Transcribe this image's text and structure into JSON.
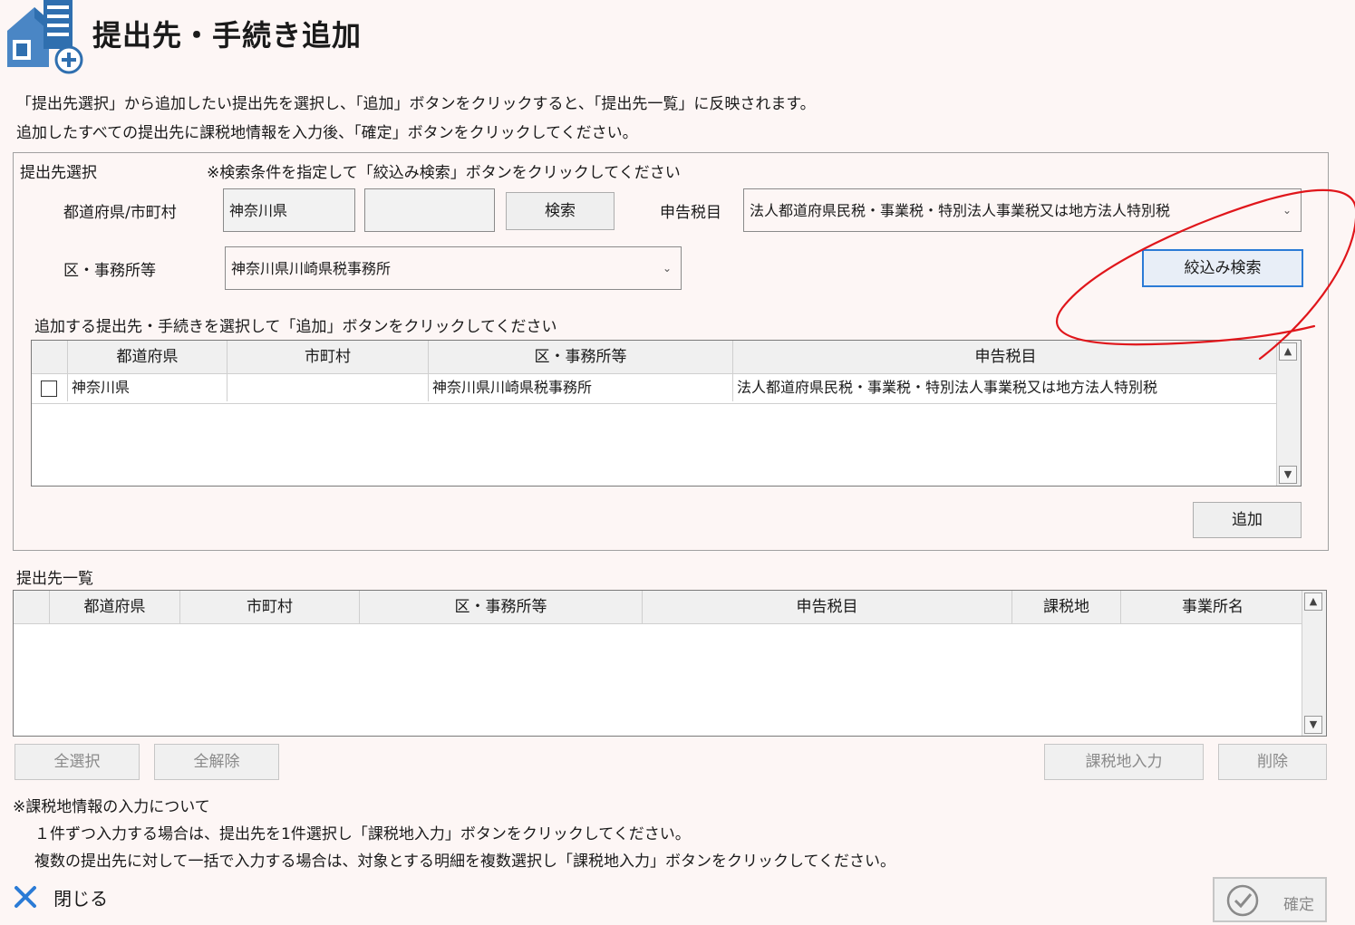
{
  "header": {
    "title": "提出先・手続き追加"
  },
  "instructions": {
    "line1": "「提出先選択」から追加したい提出先を選択し、「追加」ボタンをクリックすると、「提出先一覧」に反映されます。",
    "line2": "追加したすべての提出先に課税地情報を入力後、「確定」ボタンをクリックしてください。"
  },
  "selection": {
    "section_label": "提出先選択",
    "hint": "※検索条件を指定して「絞込み検索」ボタンをクリックしてください",
    "pref_city_label": "都道府県/市町村",
    "prefecture_value": "神奈川県",
    "city_value": "",
    "search_button": "検索",
    "tax_item_label": "申告税目",
    "tax_item_value": "法人都道府県民税・事業税・特別法人事業税又は地方法人特別税",
    "office_label": "区・事務所等",
    "office_value": "神奈川県川崎県税事務所",
    "filter_button": "絞込み検索",
    "add_instruction": "追加する提出先・手続きを選択して「追加」ボタンをクリックしてください",
    "columns": [
      "都道府県",
      "市町村",
      "区・事務所等",
      "申告税目"
    ],
    "rows": [
      {
        "prefecture": "神奈川県",
        "city": "",
        "office": "神奈川県川崎県税事務所",
        "tax_item": "法人都道府県民税・事業税・特別法人事業税又は地方法人特別税",
        "checked": false
      }
    ],
    "add_button": "追加"
  },
  "list": {
    "section_label": "提出先一覧",
    "columns": [
      "都道府県",
      "市町村",
      "区・事務所等",
      "申告税目",
      "課税地",
      "事業所名"
    ],
    "rows": [],
    "select_all_button": "全選択",
    "deselect_all_button": "全解除",
    "tax_location_button": "課税地入力",
    "delete_button": "削除"
  },
  "notes": {
    "heading": "※課税地情報の入力について",
    "line1": "１件ずつ入力する場合は、提出先を1件選択し「課税地入力」ボタンをクリックしてください。",
    "line2": "複数の提出先に対して一括で入力する場合は、対象とする明細を複数選択し「課税地入力」ボタンをクリックしてください。"
  },
  "footer": {
    "close_label": "閉じる",
    "confirm_label": "確定"
  },
  "colors": {
    "accent_blue": "#2b7bd6",
    "icon_blue": "#2f6faf",
    "annotation_red": "#e0161b",
    "background": "#fdf6f5"
  },
  "icons": [
    "folder-add-icon",
    "close-icon",
    "check-circle-icon",
    "chevron-down-icon",
    "scroll-up-icon",
    "scroll-down-icon"
  ]
}
